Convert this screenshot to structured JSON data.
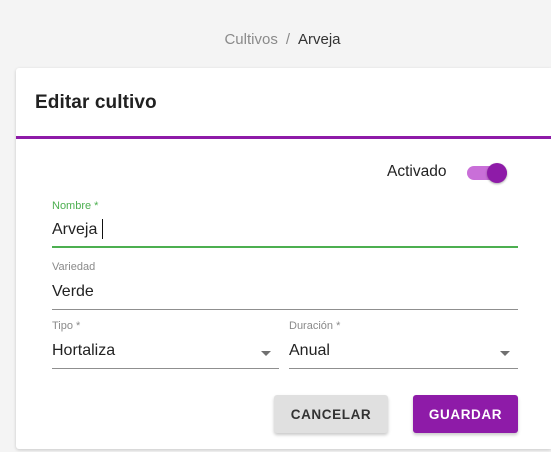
{
  "breadcrumb": {
    "parent": "Cultivos",
    "separator": "/",
    "current": "Arveja"
  },
  "card": {
    "title": "Editar cultivo"
  },
  "toggle": {
    "label": "Activado",
    "state": "on"
  },
  "form": {
    "nombre": {
      "label": "Nombre *",
      "value": "Arveja"
    },
    "variedad": {
      "label": "Variedad",
      "value": "Verde"
    },
    "tipo": {
      "label": "Tipo *",
      "value": "Hortaliza"
    },
    "duracion": {
      "label": "Duración *",
      "value": "Anual"
    }
  },
  "actions": {
    "cancel_label": "CANCELAR",
    "save_label": "GUARDAR"
  },
  "colors": {
    "accent": "#8e1ba8",
    "focus": "#4caf50"
  },
  "icons": {
    "select_arrow": "chevron-down-icon"
  }
}
